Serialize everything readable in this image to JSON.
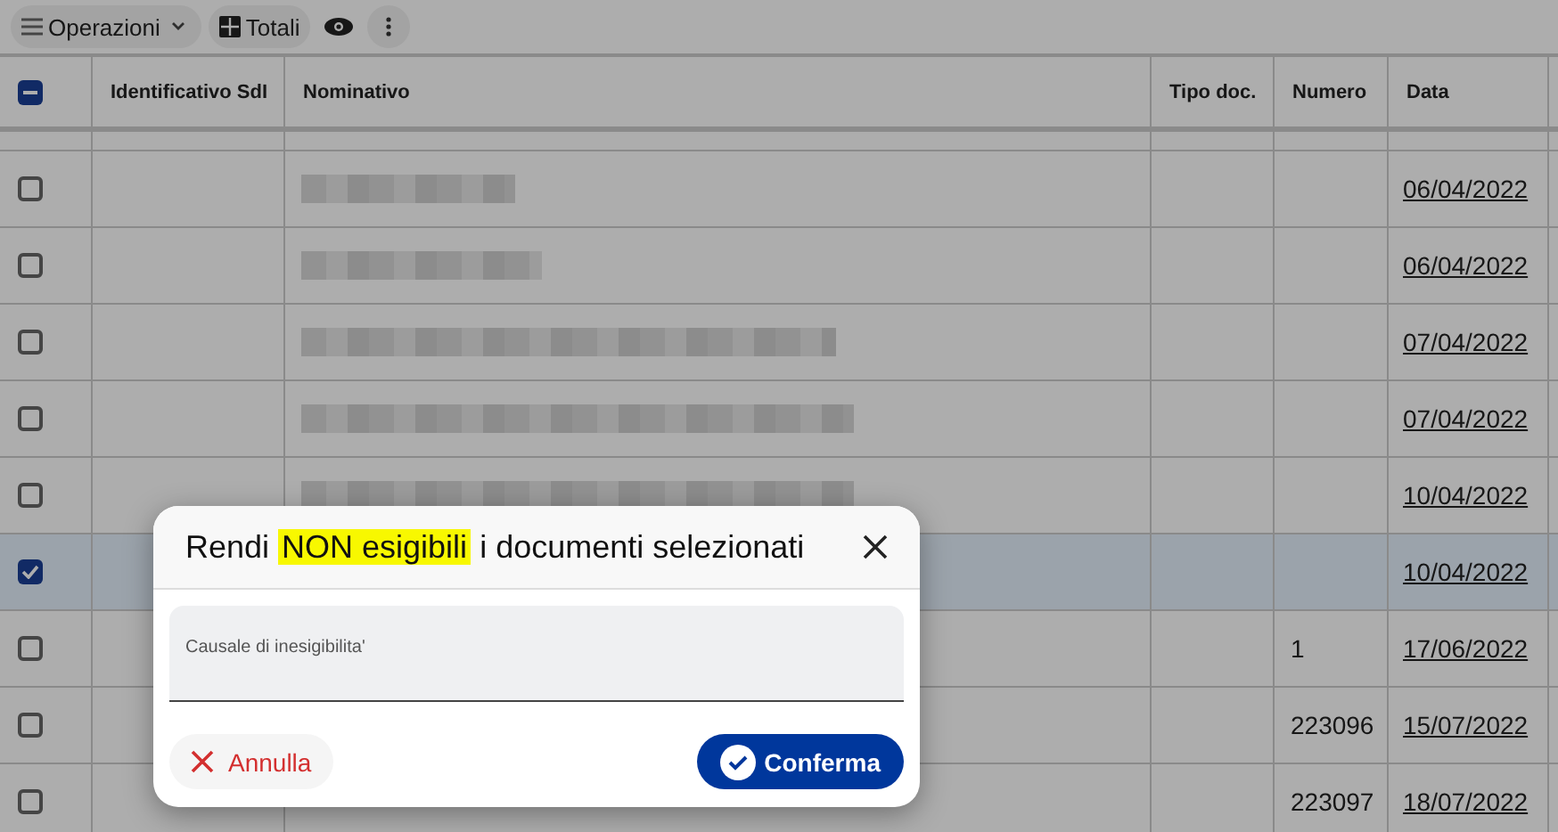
{
  "toolbar": {
    "operations": "Operazioni",
    "totals": "Totali"
  },
  "table": {
    "header_checkbox": {
      "indeterminate": true
    },
    "columns": [
      "Identificativo SdI",
      "Nominativo",
      "Tipo doc.",
      "Numero",
      "Data"
    ],
    "rows": [
      {
        "checked": false,
        "selected": false,
        "redacted": true,
        "data": "06/04/2022"
      },
      {
        "checked": false,
        "selected": false,
        "redacted": true,
        "data": "06/04/2022"
      },
      {
        "checked": false,
        "selected": false,
        "redacted": true,
        "data": "07/04/2022"
      },
      {
        "checked": false,
        "selected": false,
        "redacted": true,
        "data": "07/04/2022"
      },
      {
        "checked": false,
        "selected": false,
        "redacted": true,
        "data": "10/04/2022"
      },
      {
        "checked": true,
        "selected": true,
        "redacted": false,
        "data": "10/04/2022"
      },
      {
        "checked": false,
        "selected": false,
        "redacted": false,
        "numero": "1",
        "data": "17/06/2022"
      },
      {
        "checked": false,
        "selected": false,
        "redacted": false,
        "numero": "223096",
        "data": "15/07/2022"
      },
      {
        "checked": false,
        "selected": false,
        "redacted": false,
        "numero": "223097",
        "data": "18/07/2022"
      }
    ]
  },
  "dialog": {
    "title_before": "Rendi ",
    "title_highlight": "NON esigibili",
    "title_after": " i documenti selezionati",
    "field": {
      "label": "Causale di inesigibilita'"
    },
    "cancel": "Annulla",
    "confirm": "Conferma"
  }
}
